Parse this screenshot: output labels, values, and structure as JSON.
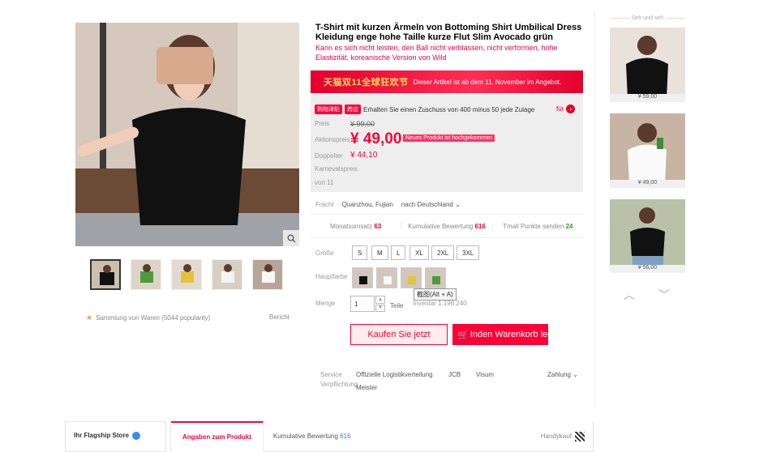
{
  "product": {
    "title": "T-Shirt mit kurzen Ärmeln von Bottoming Shirt Umbilical Dress Kleidung enge hohe Taille kurze Flut Slim Avocado grün",
    "subtitle": "Kann es sich nicht leisten, den Ball nicht verblassen, nicht verformen, hohe Elastizität, koreanische Version von Wild"
  },
  "banner": {
    "main": "天猫双11全球狂欢节",
    "sub": "Dieser Artikel ist ab dem 11. November im Angebot."
  },
  "coupon": {
    "tag": "购物津贴",
    "tag2": "跨店",
    "text": "Erhalten Sie einen Zuschuss von 400 minus 50 jede Zulage",
    "for": "für"
  },
  "prices": {
    "price_label": "Preis",
    "old": "¥ 99,00",
    "promo_label": "Aktionspreis",
    "promo": "¥ 49,00",
    "new_tag": "Neues Produkt ist hochgekommen",
    "double_label": "Doppelter",
    "double": "¥ 44,10",
    "carnival_label": "Karnevalspreis",
    "from_label": "von 11"
  },
  "shipping": {
    "label": "Fracht",
    "from": "Quanzhou, Fujian",
    "to": "nach Deutschland"
  },
  "stats": [
    {
      "label": "Monatsumsatz",
      "value": "63"
    },
    {
      "label": "Kumulative Bewertung",
      "value": "616"
    },
    {
      "label": "Tmall Punkte senden",
      "value": "24"
    }
  ],
  "sizes": {
    "label": "Größe",
    "options": [
      "S",
      "M",
      "L",
      "XL",
      "2XL",
      "3XL"
    ]
  },
  "colors": {
    "label": "Hauptfarbe",
    "tooltip": "截图(Alt + A)"
  },
  "quantity": {
    "label": "Menge",
    "value": "1",
    "unit": "Teile",
    "stock": "Inventar 1.196.240"
  },
  "actions": {
    "buy_now": "Kaufen Sie jetzt",
    "add_cart": "Inden Warenkorb leg"
  },
  "service": {
    "label": "Service",
    "label2": "Verpflichtung",
    "items": [
      "Offizielle Logistikverteilung",
      "JCB",
      "Visum"
    ],
    "item_meister": "Meister",
    "payment": "Zahlung"
  },
  "left": {
    "favorites": "Sammlung von Waren (5044 popularity)",
    "report": "Bericht"
  },
  "recommend": {
    "title": "Seh und seh",
    "items": [
      {
        "price": "¥ 59,00"
      },
      {
        "price": "¥ 49,00"
      },
      {
        "price": "¥ 56,00"
      }
    ]
  },
  "bottom": {
    "store": "Ihr Flagship Store",
    "tab_active": "Angaben zum Produkt",
    "tab2": "Kumulative Bewertung",
    "tab2_count": "616",
    "mobile": "Handykauf"
  },
  "colors_theme": {
    "accent": "#ff0036",
    "banner": "#e4002b"
  }
}
